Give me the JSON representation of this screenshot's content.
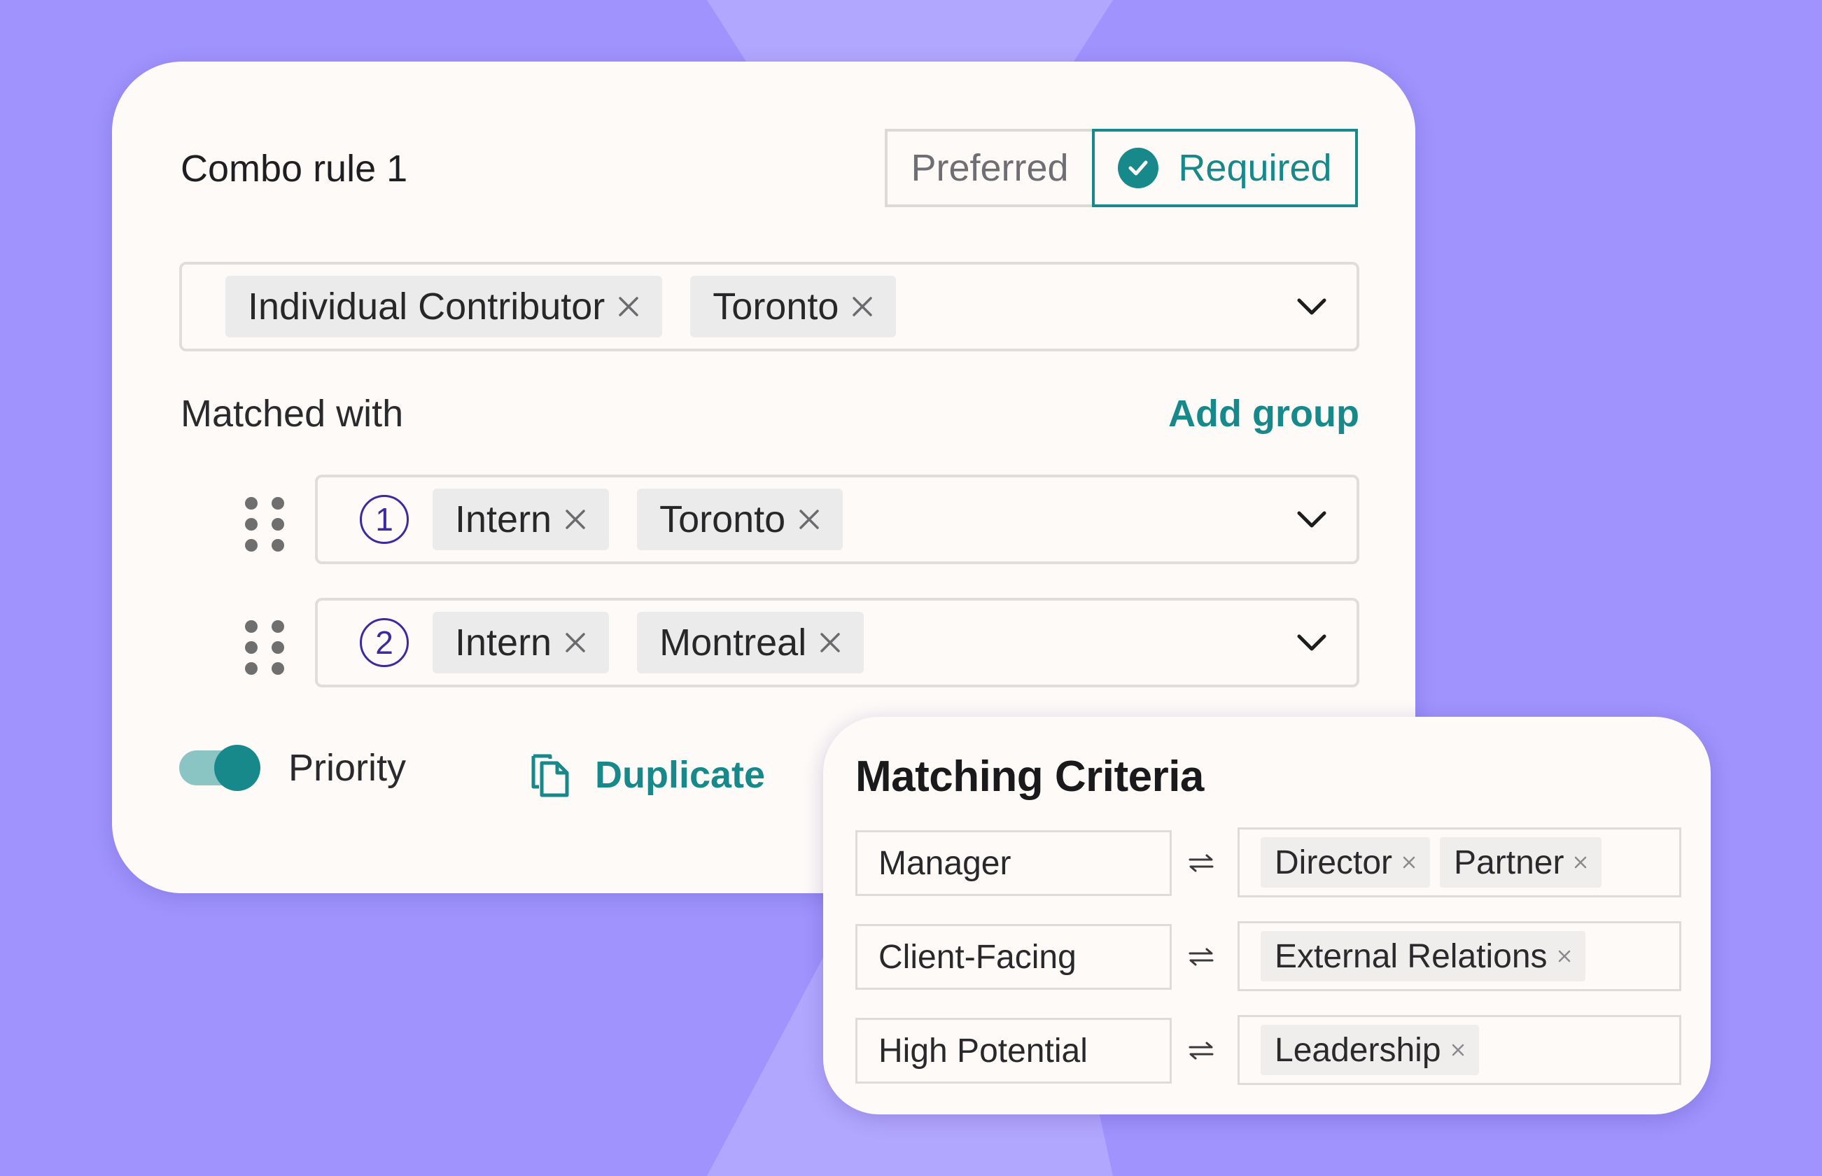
{
  "colors": {
    "background": "#a093fd",
    "card": "#fdfaf8",
    "accent": "#18898a",
    "group_number": "#3b2aa0"
  },
  "rule": {
    "title": "Combo rule 1",
    "mode_options": [
      {
        "label": "Preferred",
        "selected": false
      },
      {
        "label": "Required",
        "selected": true,
        "icon": "check-circle-icon"
      }
    ],
    "selected_tags": [
      "Individual Contributor",
      "Toronto"
    ],
    "matched_with_label": "Matched with",
    "add_group_label": "Add group",
    "groups": [
      {
        "number": "1",
        "tags": [
          "Intern",
          "Toronto"
        ]
      },
      {
        "number": "2",
        "tags": [
          "Intern",
          "Montreal"
        ]
      }
    ],
    "priority_label": "Priority",
    "priority_enabled": true,
    "duplicate_label": "Duplicate"
  },
  "matching_criteria": {
    "title": "Matching Criteria",
    "rows": [
      {
        "source": "Manager",
        "targets": [
          "Director",
          "Partner"
        ]
      },
      {
        "source": "Client-Facing",
        "targets": [
          "External Relations"
        ]
      },
      {
        "source": "High Potential",
        "targets": [
          "Leadership"
        ]
      }
    ]
  }
}
